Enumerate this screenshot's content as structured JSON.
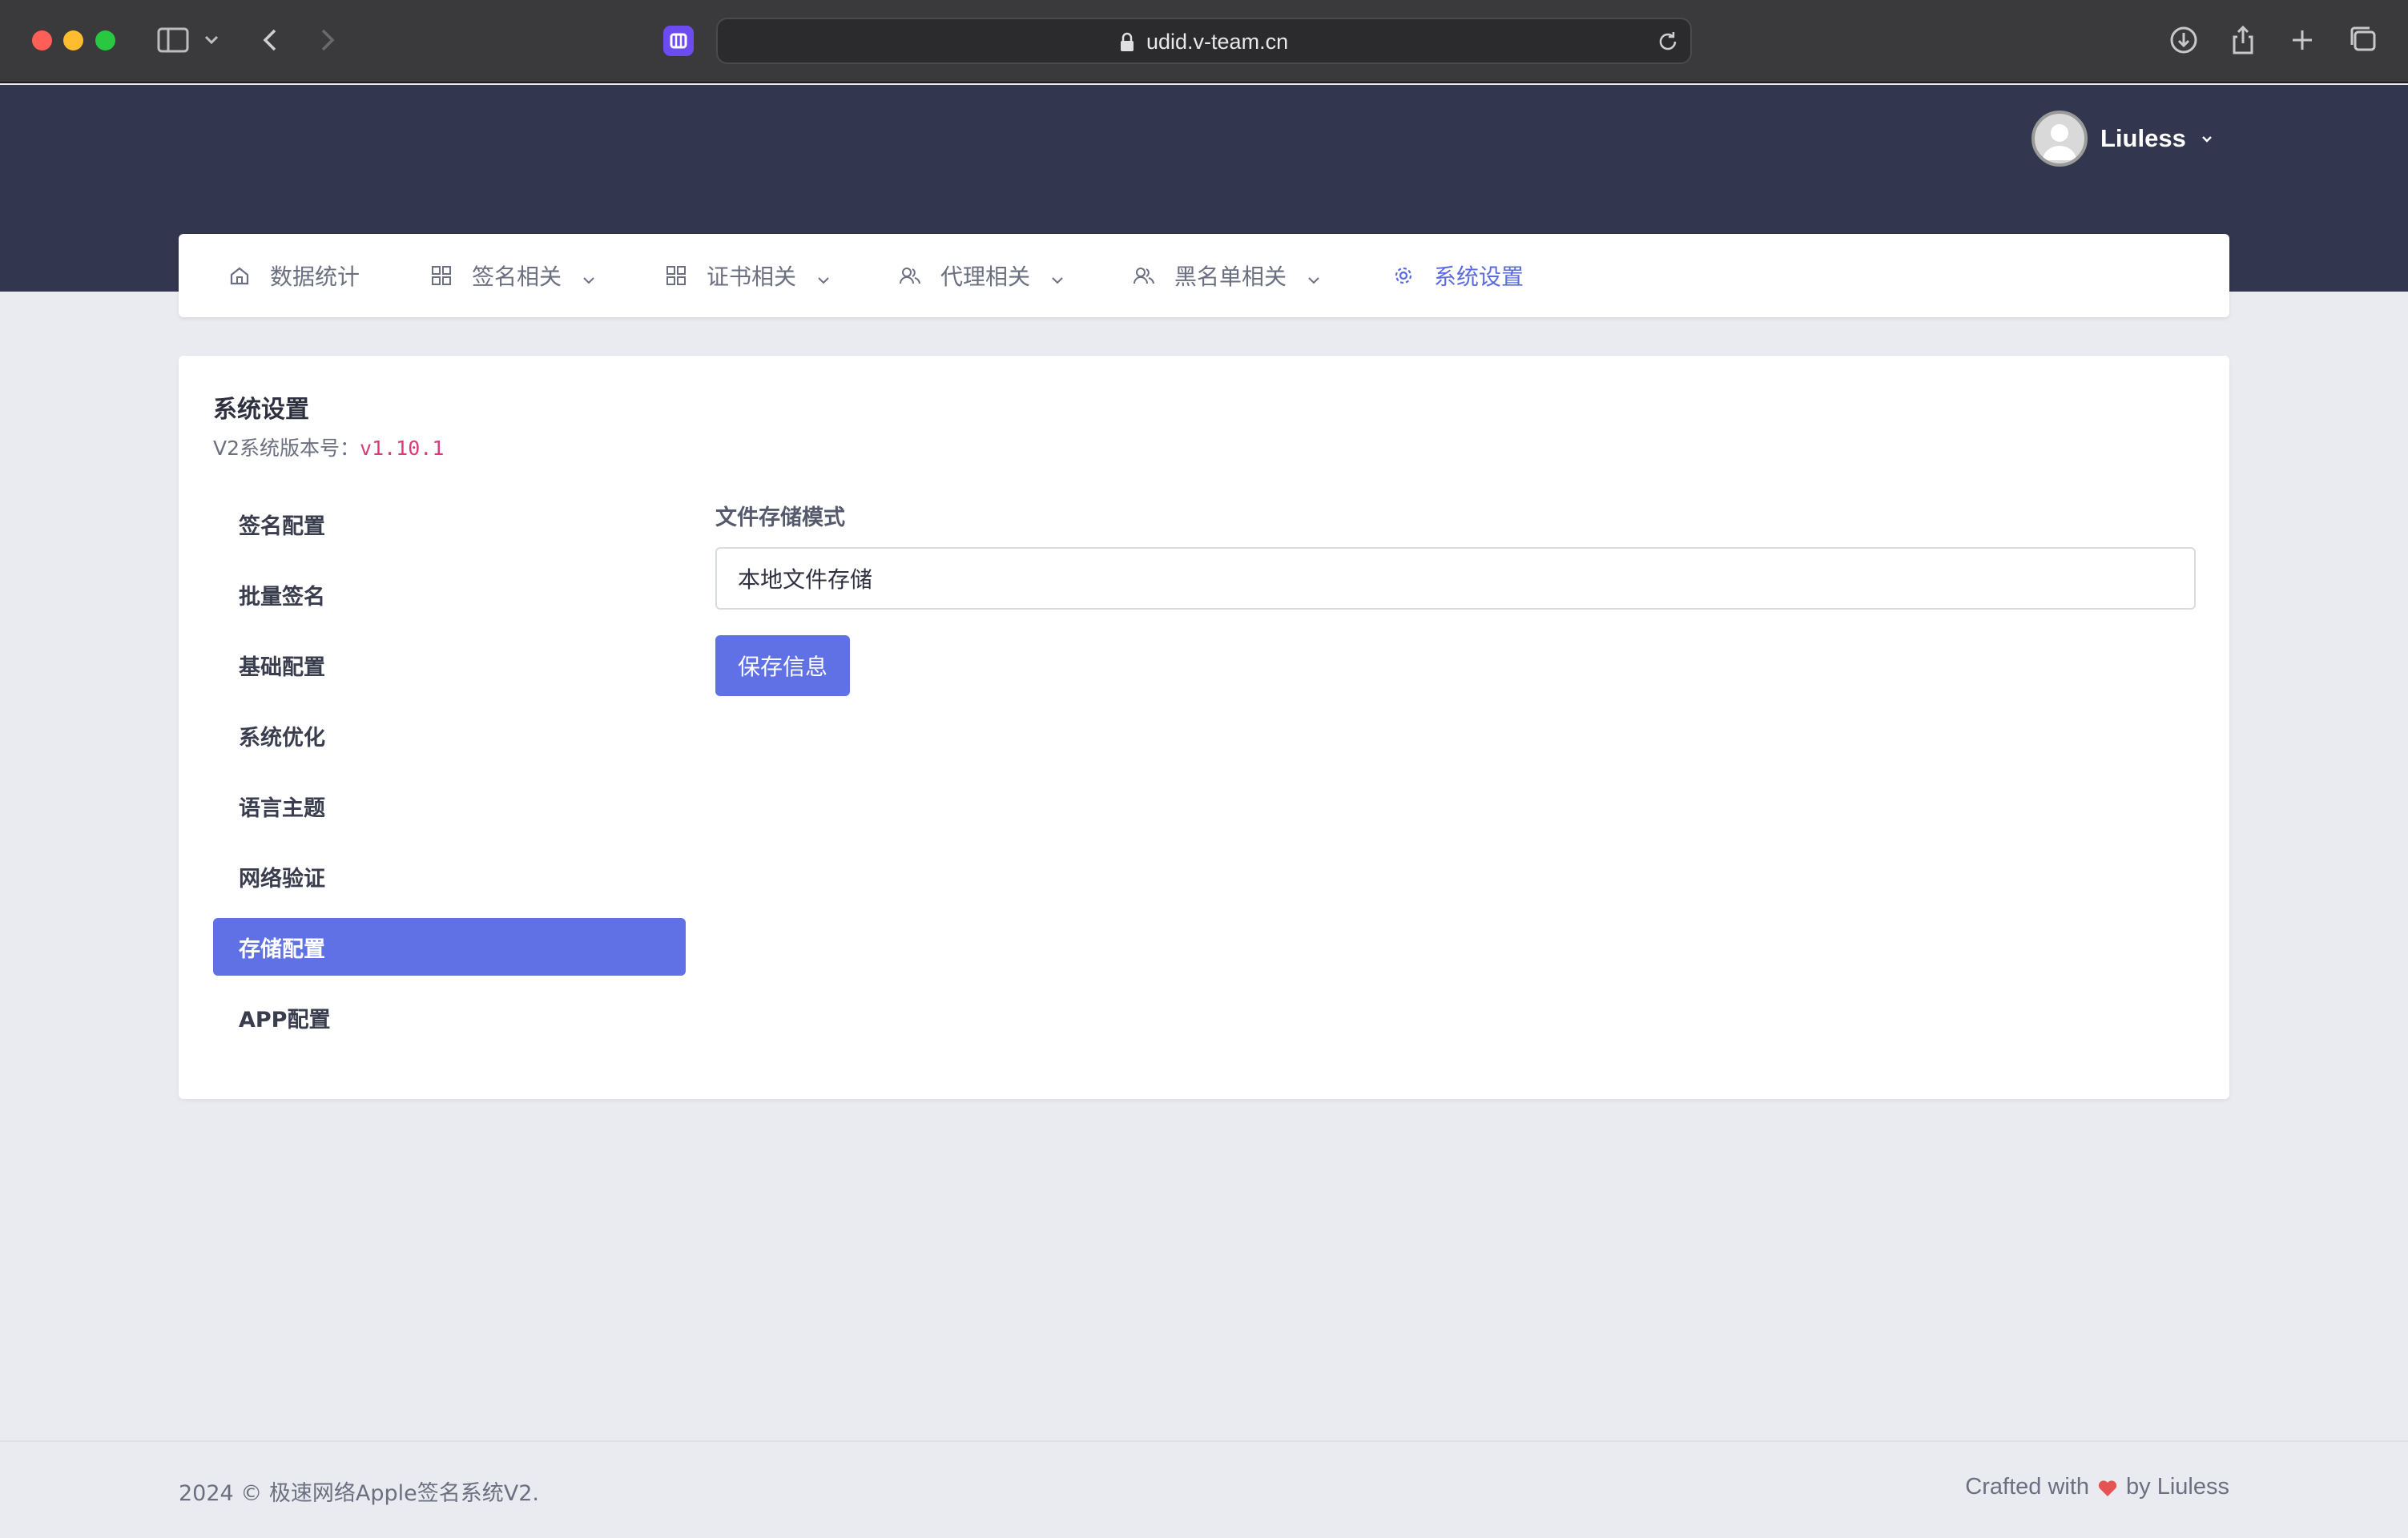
{
  "browser": {
    "url": "udid.v-team.cn"
  },
  "user": {
    "name": "Liuless"
  },
  "nav": {
    "items": [
      {
        "label": "数据统计",
        "icon": "home-icon",
        "has_caret": false
      },
      {
        "label": "签名相关",
        "icon": "grid-icon",
        "has_caret": true
      },
      {
        "label": "证书相关",
        "icon": "grid-icon",
        "has_caret": true
      },
      {
        "label": "代理相关",
        "icon": "users-icon",
        "has_caret": true
      },
      {
        "label": "黑名单相关",
        "icon": "users-icon",
        "has_caret": true
      },
      {
        "label": "系统设置",
        "icon": "gear-icon",
        "has_caret": false,
        "active": true
      }
    ]
  },
  "card": {
    "title": "系统设置",
    "version_label": "V2系统版本号：",
    "version_value": "v1.10.1"
  },
  "side_menu": {
    "items": [
      {
        "label": "签名配置"
      },
      {
        "label": "批量签名"
      },
      {
        "label": "基础配置"
      },
      {
        "label": "系统优化"
      },
      {
        "label": "语言主题"
      },
      {
        "label": "网络验证"
      },
      {
        "label": "存储配置",
        "active": true
      },
      {
        "label": "APP配置"
      }
    ]
  },
  "form": {
    "label": "文件存储模式",
    "value": "本地文件存储",
    "save_label": "保存信息"
  },
  "footer": {
    "left": "2024 © 极速网络Apple签名系统V2.",
    "right_prefix": "Crafted with",
    "right_suffix": "by Liuless"
  },
  "colors": {
    "accent": "#5f71e4",
    "header_band": "#32364e",
    "heart": "#e55353",
    "version": "#d63b7a"
  }
}
